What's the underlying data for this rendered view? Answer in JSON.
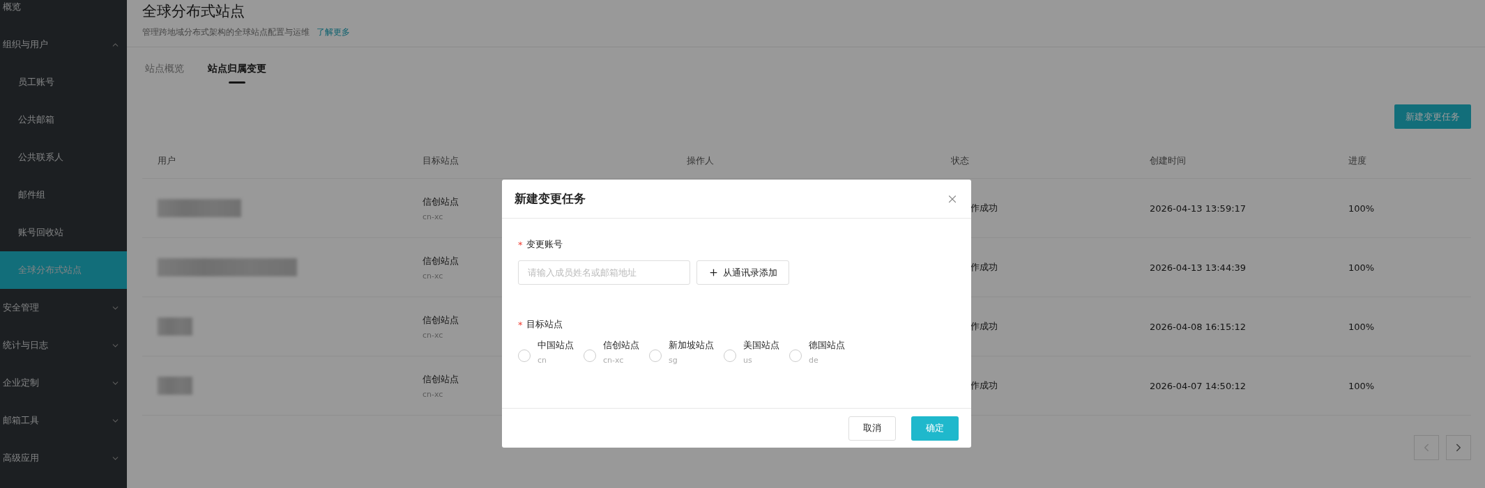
{
  "sidebar": {
    "items": [
      {
        "label": "概览",
        "selected": false
      },
      {
        "label": "组织与用户",
        "selected": false,
        "expanded": true,
        "children": [
          {
            "label": "员工账号",
            "selected": false
          },
          {
            "label": "公共邮箱",
            "selected": false
          },
          {
            "label": "公共联系人",
            "selected": false
          },
          {
            "label": "邮件组",
            "selected": false
          },
          {
            "label": "账号回收站",
            "selected": false
          },
          {
            "label": "全球分布式站点",
            "selected": true
          }
        ]
      },
      {
        "label": "安全管理",
        "selected": false,
        "expanded": false
      },
      {
        "label": "统计与日志",
        "selected": false,
        "expanded": false
      },
      {
        "label": "企业定制",
        "selected": false,
        "expanded": false
      },
      {
        "label": "邮箱工具",
        "selected": false,
        "expanded": false
      },
      {
        "label": "高级应用",
        "selected": false,
        "expanded": false
      }
    ]
  },
  "page": {
    "title": "全球分布式站点",
    "subtitle": "管理跨地域分布式架构的全球站点配置与运维",
    "link": "了解更多"
  },
  "tabs": [
    {
      "label": "站点概览",
      "selected": false
    },
    {
      "label": "站点归属变更",
      "selected": true
    }
  ],
  "new_button": "新建变更任务",
  "table": {
    "columns": [
      "用户",
      "目标站点",
      "操作人",
      "状态",
      "创建时间",
      "进度"
    ],
    "rows": [
      {
        "user_redacted": true,
        "site": "信创站点",
        "site_code": "cn-xc",
        "status": "作成功",
        "created": "2026-04-13 13:59:17",
        "progress": "100%"
      },
      {
        "user_redacted": true,
        "site": "信创站点",
        "site_code": "cn-xc",
        "status": "作成功",
        "created": "2026-04-13 13:44:39",
        "progress": "100%"
      },
      {
        "user_redacted": true,
        "site": "信创站点",
        "site_code": "cn-xc",
        "status": "作成功",
        "created": "2026-04-08 16:15:12",
        "progress": "100%"
      },
      {
        "user_redacted": true,
        "site": "信创站点",
        "site_code": "cn-xc",
        "status": "作成功",
        "created": "2026-04-07 14:50:12",
        "progress": "100%"
      }
    ]
  },
  "pagination": {
    "prev_disabled": true,
    "next_disabled": false
  },
  "dialog": {
    "title": "新建变更任务",
    "account": {
      "label": "变更账号",
      "required_mark": "*",
      "placeholder": "请输入成员姓名或邮箱地址",
      "add_button": "从通讯录添加"
    },
    "site": {
      "label": "目标站点",
      "required_mark": "*",
      "options": [
        {
          "label": "中国站点",
          "code": "cn",
          "selected": false
        },
        {
          "label": "信创站点",
          "code": "cn-xc",
          "selected": false
        },
        {
          "label": "新加坡站点",
          "code": "sg",
          "selected": false
        },
        {
          "label": "美国站点",
          "code": "us",
          "selected": false
        },
        {
          "label": "德国站点",
          "code": "de",
          "selected": false
        }
      ]
    },
    "cancel": "取消",
    "ok": "确定"
  }
}
